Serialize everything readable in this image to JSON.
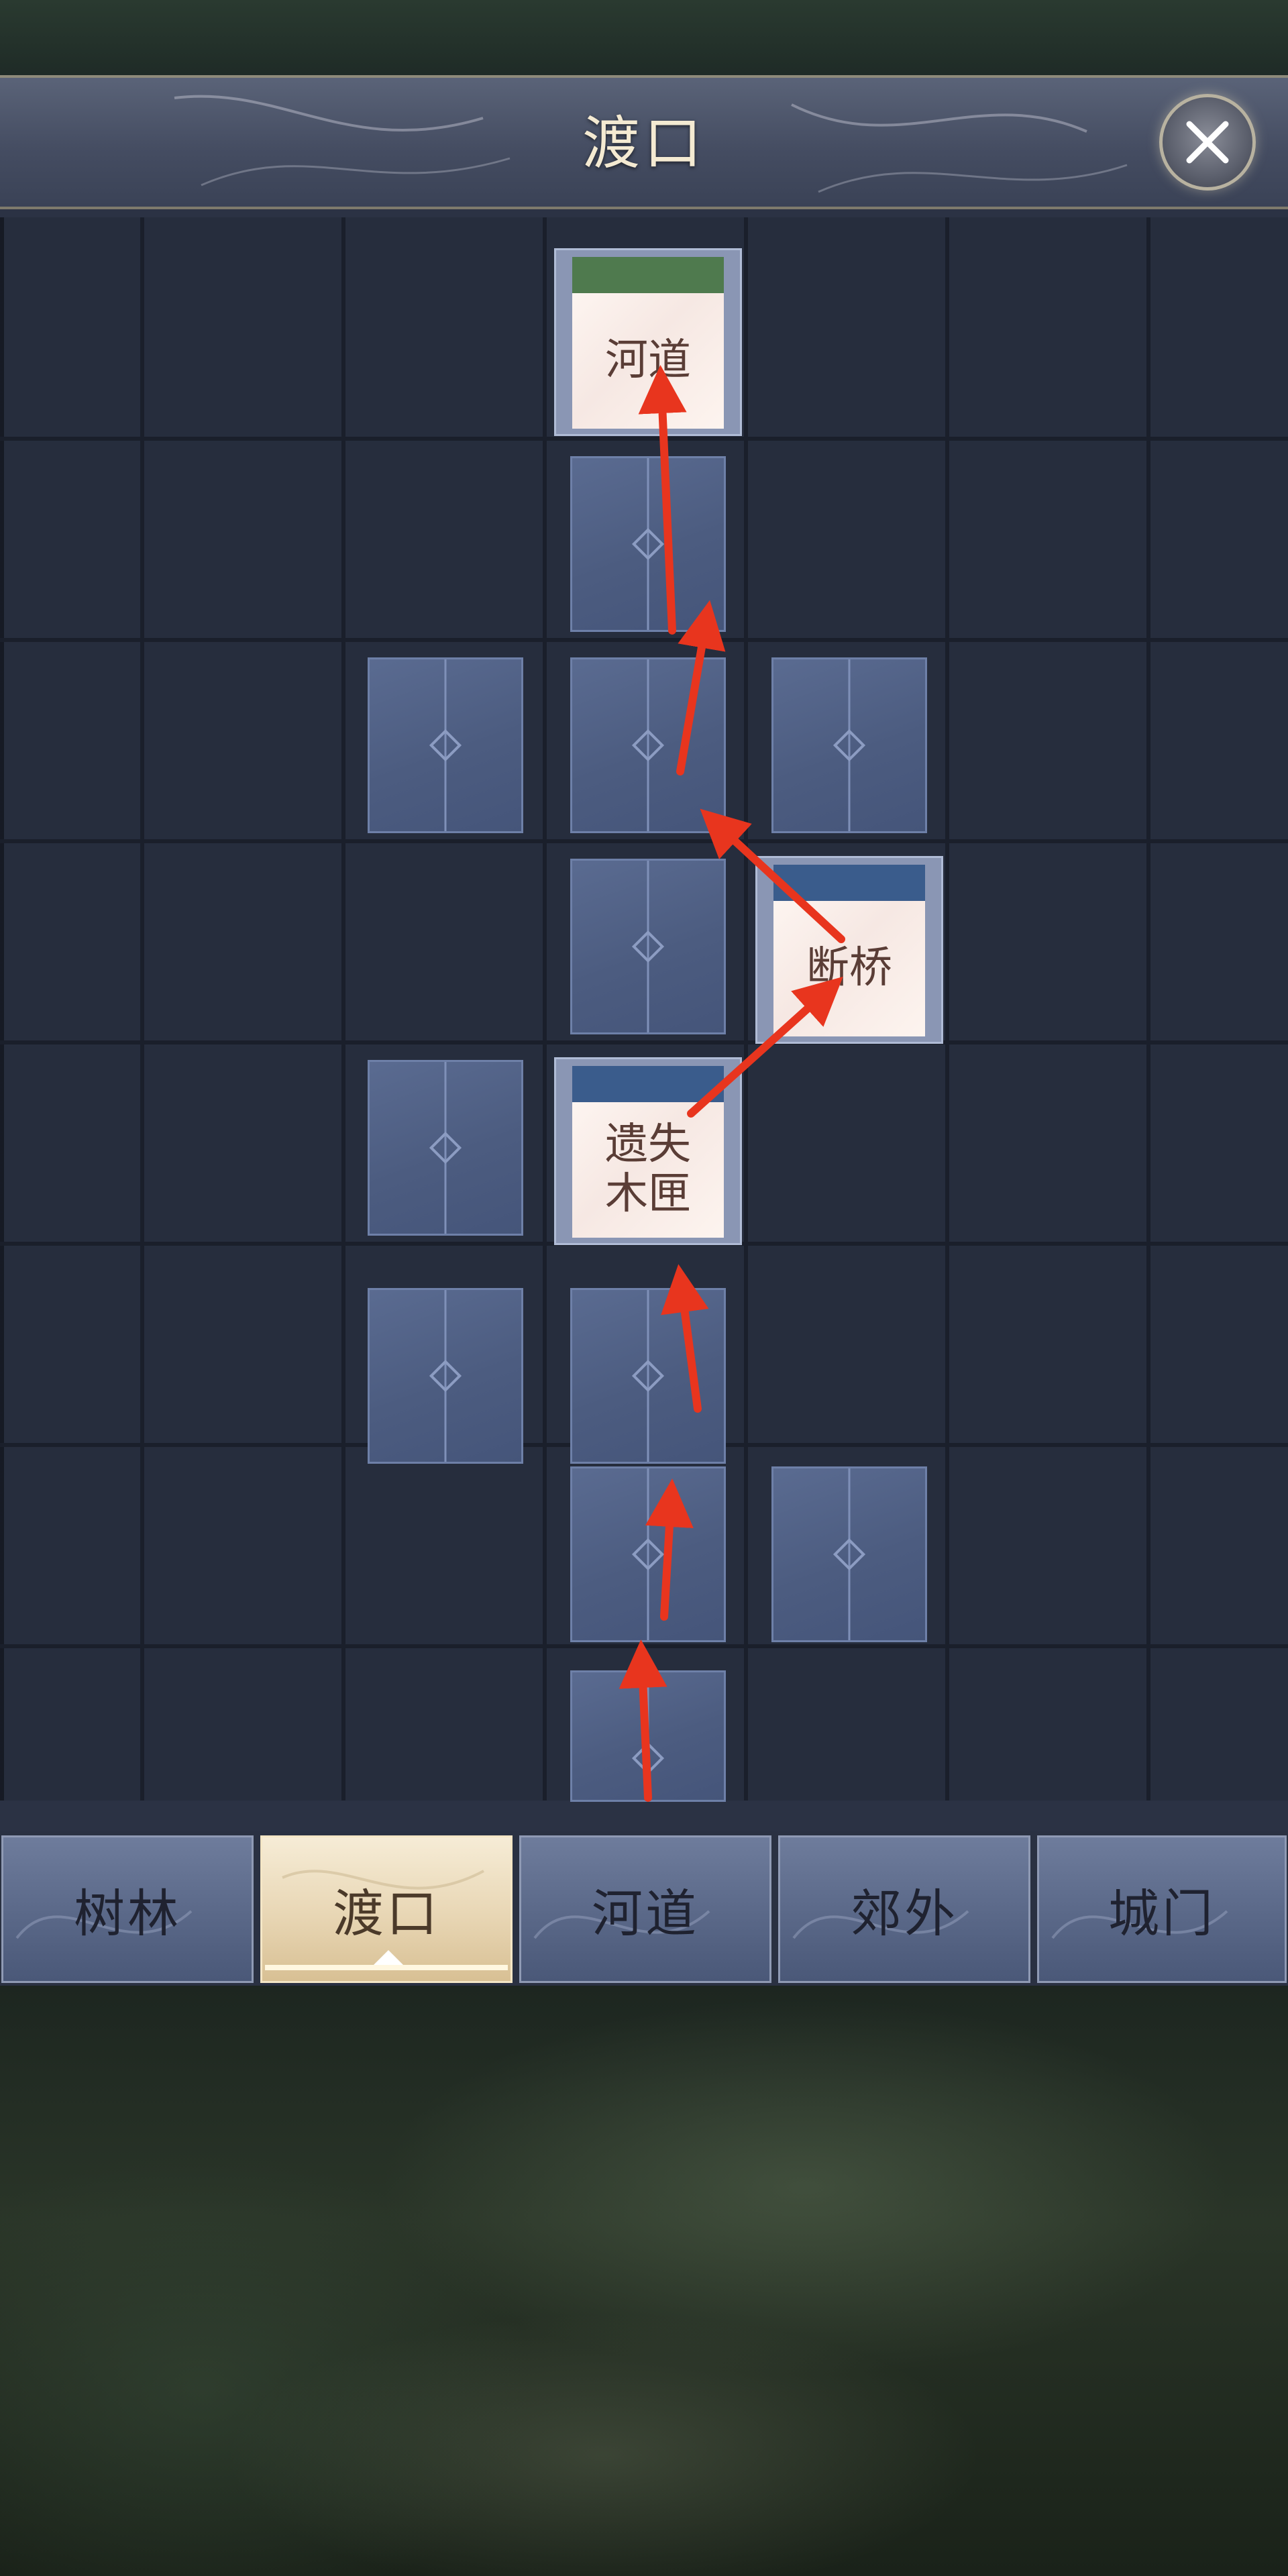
{
  "header": {
    "title": "渡口",
    "close_icon": "close-icon"
  },
  "map": {
    "cards": [
      {
        "label": "河道",
        "band_color": "#4f7a4e"
      },
      {
        "label": "断桥",
        "band_color": "#3a5c8c"
      },
      {
        "label": "遗失\n木匣",
        "band_color": "#3a5c8c"
      }
    ],
    "route_color": "#e8351e"
  },
  "tabs": [
    {
      "label": "树林",
      "active": false
    },
    {
      "label": "渡口",
      "active": true
    },
    {
      "label": "河道",
      "active": false
    },
    {
      "label": "郊外",
      "active": false
    },
    {
      "label": "城门",
      "active": false
    }
  ],
  "colors": {
    "tile": "#4c5c80",
    "panel": "#2b3244",
    "active_tab": "#e8d6b4"
  }
}
